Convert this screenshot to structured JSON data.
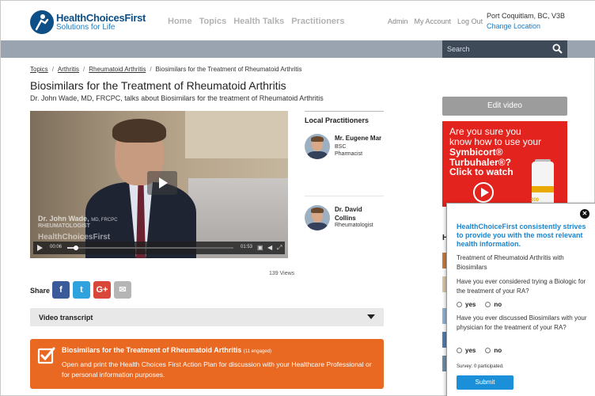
{
  "brand": {
    "name": "HealthChoicesFirst",
    "tagline": "Solutions for Life"
  },
  "nav": {
    "items": [
      "Home",
      "Topics",
      "Health Talks",
      "Practitioners"
    ]
  },
  "user_nav": {
    "items": [
      "Admin",
      "My Account",
      "Log Out"
    ]
  },
  "location": {
    "city": "Port Coquitlam, BC, V3B",
    "change_label": "Change Location"
  },
  "search": {
    "placeholder": "Search"
  },
  "breadcrumb": {
    "items": [
      "Topics",
      "Arthritis",
      "Rheumatoid Arthritis"
    ],
    "current": "Biosimilars for the Treatment of Rheumatoid Arthritis"
  },
  "page": {
    "title": "Biosimilars for the Treatment of Rheumatoid Arthritis",
    "subtitle": "Dr. John Wade, MD, FRCPC, talks about Biosimilars for the treatment of Rheumatoid Arthritis"
  },
  "video": {
    "presenter_name": "Dr. John Wade",
    "presenter_creds": "MD, FRCPC",
    "presenter_title": "RHEUMATOLOGIST",
    "watermark": "HealthChoicesFirst",
    "current_time": "00:06",
    "total_time": "01:53",
    "progress": 0.05,
    "views": "139 Views"
  },
  "share": {
    "label": "Share",
    "buttons": [
      "f",
      "t",
      "G+",
      "✉"
    ]
  },
  "transcript": {
    "label": "Video transcript"
  },
  "action_plan": {
    "title": "Biosimilars for the Treatment of Rheumatoid Arthritis",
    "count": "(11 engaged)",
    "text": "Open and print the Health Choices First Action Plan for discussion with your Healthcare Professional or for personal information purposes."
  },
  "practitioners": {
    "title": "Local Practitioners",
    "items": [
      {
        "name": "Mr. Eugene Mar",
        "line1": "BSC",
        "line2": "Pharmacist"
      },
      {
        "name_line1": "Dr. David",
        "name_line2": "Collins",
        "line1": "Rheumatologist"
      }
    ]
  },
  "sidebar": {
    "edit_label": "Edit video"
  },
  "ad": {
    "question_line1": "Are you sure you",
    "question_line2": "know how to use your",
    "question_product": "Symbicort® Turbuhaler®?",
    "cta": "Click to watch",
    "mini_label": "200"
  },
  "behind_heading": "H",
  "survey": {
    "close": "✕",
    "heading": "HealthChoiceFirst consistently strives to provide you with the most relevant health information.",
    "topic": "Treatment of Rheumatoid Arthritis with Biosimilars",
    "questions": [
      "Have you ever considered trying a Biologic for the treatment of your RA?",
      "Have you ever discussed Biosimilars with your physician for the treatment of your RA?"
    ],
    "yes": "yes",
    "no": "no",
    "stat": "Survey: 0 participated.",
    "submit": "Submit"
  },
  "colors": {
    "brand": "#0d4f86",
    "accent_orange": "#e96822",
    "link_blue": "#1a7ac4",
    "ad_red": "#e3231d",
    "facebook": "#3b5a9a",
    "twitter": "#2ea3dd",
    "google": "#d9473a",
    "email": "#b5b5b5"
  }
}
